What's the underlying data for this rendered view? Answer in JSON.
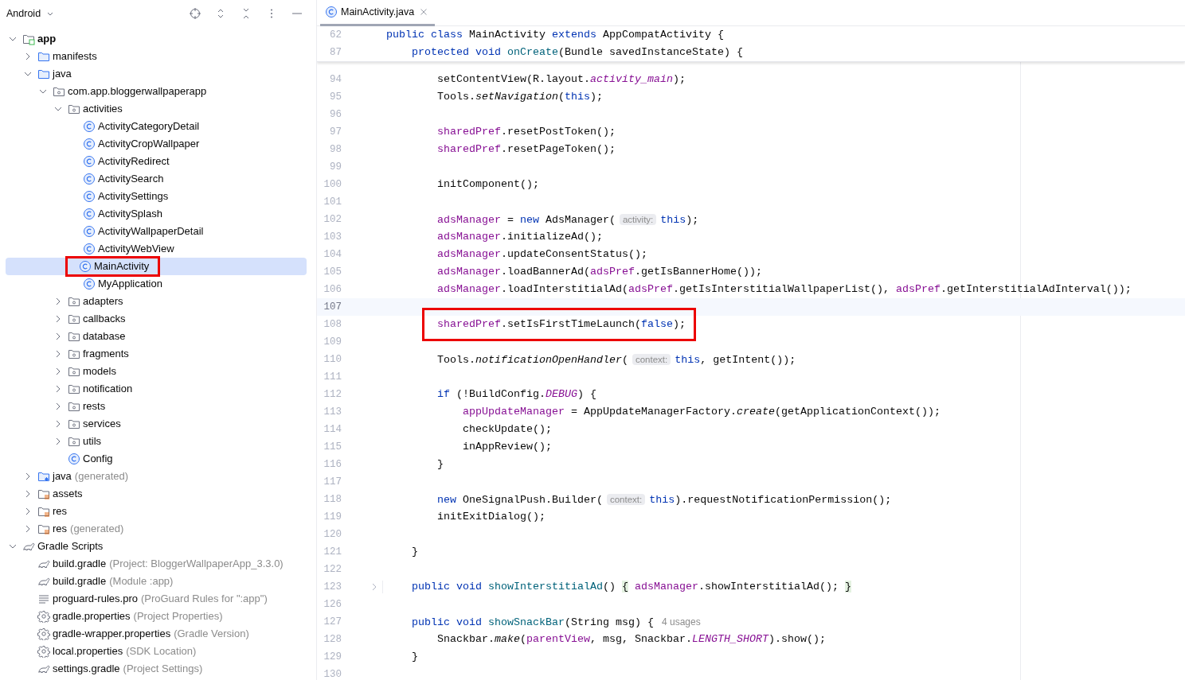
{
  "project_panel": {
    "title": "Android",
    "tree": [
      {
        "kind": "module",
        "label": "app",
        "expanded": true,
        "selected": false,
        "boxed": false,
        "children": [
          {
            "kind": "folder",
            "label": "manifests",
            "expanded": false,
            "selected": false,
            "boxed": false
          },
          {
            "kind": "folder",
            "label": "java",
            "expanded": true,
            "selected": false,
            "boxed": false,
            "children": [
              {
                "kind": "package",
                "label": "com.app.bloggerwallpaperapp",
                "expanded": true,
                "selected": false,
                "boxed": false,
                "children": [
                  {
                    "kind": "package",
                    "label": "activities",
                    "expanded": true,
                    "selected": false,
                    "boxed": false,
                    "children": [
                      {
                        "kind": "class",
                        "label": "ActivityCategoryDetail",
                        "selected": false,
                        "boxed": false
                      },
                      {
                        "kind": "class",
                        "label": "ActivityCropWallpaper",
                        "selected": false,
                        "boxed": false
                      },
                      {
                        "kind": "class",
                        "label": "ActivityRedirect",
                        "selected": false,
                        "boxed": false
                      },
                      {
                        "kind": "class",
                        "label": "ActivitySearch",
                        "selected": false,
                        "boxed": false
                      },
                      {
                        "kind": "class",
                        "label": "ActivitySettings",
                        "selected": false,
                        "boxed": false
                      },
                      {
                        "kind": "class",
                        "label": "ActivitySplash",
                        "selected": false,
                        "boxed": false
                      },
                      {
                        "kind": "class",
                        "label": "ActivityWallpaperDetail",
                        "selected": false,
                        "boxed": false
                      },
                      {
                        "kind": "class",
                        "label": "ActivityWebView",
                        "selected": false,
                        "boxed": false
                      },
                      {
                        "kind": "class",
                        "label": "MainActivity",
                        "selected": true,
                        "boxed": true
                      },
                      {
                        "kind": "class",
                        "label": "MyApplication",
                        "selected": false,
                        "boxed": false
                      }
                    ]
                  },
                  {
                    "kind": "package",
                    "label": "adapters",
                    "expanded": false,
                    "selected": false,
                    "boxed": false
                  },
                  {
                    "kind": "package",
                    "label": "callbacks",
                    "expanded": false,
                    "selected": false,
                    "boxed": false
                  },
                  {
                    "kind": "package",
                    "label": "database",
                    "expanded": false,
                    "selected": false,
                    "boxed": false
                  },
                  {
                    "kind": "package",
                    "label": "fragments",
                    "expanded": false,
                    "selected": false,
                    "boxed": false
                  },
                  {
                    "kind": "package",
                    "label": "models",
                    "expanded": false,
                    "selected": false,
                    "boxed": false
                  },
                  {
                    "kind": "package",
                    "label": "notification",
                    "expanded": false,
                    "selected": false,
                    "boxed": false
                  },
                  {
                    "kind": "package",
                    "label": "rests",
                    "expanded": false,
                    "selected": false,
                    "boxed": false
                  },
                  {
                    "kind": "package",
                    "label": "services",
                    "expanded": false,
                    "selected": false,
                    "boxed": false
                  },
                  {
                    "kind": "package",
                    "label": "utils",
                    "expanded": false,
                    "selected": false,
                    "boxed": false
                  },
                  {
                    "kind": "class",
                    "label": "Config",
                    "selected": false,
                    "boxed": false
                  }
                ]
              }
            ]
          },
          {
            "kind": "gen-folder",
            "label": "java",
            "note": "(generated)",
            "expanded": false,
            "selected": false,
            "boxed": false
          },
          {
            "kind": "res-folder",
            "label": "assets",
            "expanded": false,
            "selected": false,
            "boxed": false
          },
          {
            "kind": "res-folder",
            "label": "res",
            "expanded": false,
            "selected": false,
            "boxed": false
          },
          {
            "kind": "res-folder",
            "label": "res",
            "note": "(generated)",
            "expanded": false,
            "selected": false,
            "boxed": false
          }
        ]
      },
      {
        "kind": "gradle",
        "label": "Gradle Scripts",
        "expanded": true,
        "selected": false,
        "boxed": false,
        "children": [
          {
            "kind": "gradle",
            "label": "build.gradle",
            "note": "(Project: BloggerWallpaperApp_3.3.0)",
            "selected": false,
            "boxed": false
          },
          {
            "kind": "gradle",
            "label": "build.gradle",
            "note": "(Module :app)",
            "selected": false,
            "boxed": false
          },
          {
            "kind": "text-file",
            "label": "proguard-rules.pro",
            "note": "(ProGuard Rules for \":app\")",
            "selected": false,
            "boxed": false
          },
          {
            "kind": "settings-file",
            "label": "gradle.properties",
            "note": "(Project Properties)",
            "selected": false,
            "boxed": false
          },
          {
            "kind": "settings-file",
            "label": "gradle-wrapper.properties",
            "note": "(Gradle Version)",
            "selected": false,
            "boxed": false
          },
          {
            "kind": "settings-file",
            "label": "local.properties",
            "note": "(SDK Location)",
            "selected": false,
            "boxed": false
          },
          {
            "kind": "gradle",
            "label": "settings.gradle",
            "note": "(Project Settings)",
            "selected": false,
            "boxed": false
          }
        ]
      }
    ]
  },
  "editor": {
    "tab": {
      "label": "MainActivity.java",
      "selected": true
    },
    "sticky_lines": [
      {
        "number": "62",
        "tokens": [
          {
            "kind": "keyword",
            "text": "public class"
          },
          {
            "kind": "plain",
            "text": " MainActivity "
          },
          {
            "kind": "keyword",
            "text": "extends"
          },
          {
            "kind": "plain",
            "text": " AppCompatActivity {"
          }
        ]
      },
      {
        "number": "87",
        "tokens": [
          {
            "kind": "keyword",
            "text": "    protected void "
          },
          {
            "kind": "declaration",
            "text": "onCreate"
          },
          {
            "kind": "plain",
            "text": "(Bundle savedInstanceState) {"
          }
        ]
      }
    ],
    "lines": [
      {
        "number": "94",
        "current": false,
        "boxed": false,
        "folded": false,
        "tokens": [
          {
            "kind": "plain",
            "text": "        setContentView(R.layout."
          },
          {
            "kind": "constant",
            "text": "activity_main"
          },
          {
            "kind": "plain",
            "text": ");"
          }
        ]
      },
      {
        "number": "95",
        "current": false,
        "boxed": false,
        "folded": false,
        "tokens": [
          {
            "kind": "plain",
            "text": "        Tools."
          },
          {
            "kind": "static",
            "text": "setNavigation"
          },
          {
            "kind": "plain",
            "text": "("
          },
          {
            "kind": "keyword",
            "text": "this"
          },
          {
            "kind": "plain",
            "text": ");"
          }
        ]
      },
      {
        "number": "96",
        "current": false,
        "boxed": false,
        "folded": false
      },
      {
        "number": "97",
        "current": false,
        "boxed": false,
        "folded": false,
        "tokens": [
          {
            "kind": "field",
            "text": "        sharedPref"
          },
          {
            "kind": "plain",
            "text": ".resetPostToken();"
          }
        ]
      },
      {
        "number": "98",
        "current": false,
        "boxed": false,
        "folded": false,
        "tokens": [
          {
            "kind": "field",
            "text": "        sharedPref"
          },
          {
            "kind": "plain",
            "text": ".resetPageToken();"
          }
        ]
      },
      {
        "number": "99",
        "current": false,
        "boxed": false,
        "folded": false
      },
      {
        "number": "100",
        "current": false,
        "boxed": false,
        "folded": false,
        "tokens": [
          {
            "kind": "plain",
            "text": "        initComponent();"
          }
        ]
      },
      {
        "number": "101",
        "current": false,
        "boxed": false,
        "folded": false
      },
      {
        "number": "102",
        "current": false,
        "boxed": false,
        "folded": false,
        "tokens": [
          {
            "kind": "field",
            "text": "        adsManager"
          },
          {
            "kind": "plain",
            "text": " = "
          },
          {
            "kind": "keyword",
            "text": "new"
          },
          {
            "kind": "plain",
            "text": " AdsManager("
          },
          {
            "kind": "hint",
            "text": "activity:"
          },
          {
            "kind": "keyword",
            "text": "this"
          },
          {
            "kind": "plain",
            "text": ");"
          }
        ]
      },
      {
        "number": "103",
        "current": false,
        "boxed": false,
        "folded": false,
        "tokens": [
          {
            "kind": "field",
            "text": "        adsManager"
          },
          {
            "kind": "plain",
            "text": ".initializeAd();"
          }
        ]
      },
      {
        "number": "104",
        "current": false,
        "boxed": false,
        "folded": false,
        "tokens": [
          {
            "kind": "field",
            "text": "        adsManager"
          },
          {
            "kind": "plain",
            "text": ".updateConsentStatus();"
          }
        ]
      },
      {
        "number": "105",
        "current": false,
        "boxed": false,
        "folded": false,
        "tokens": [
          {
            "kind": "field",
            "text": "        adsManager"
          },
          {
            "kind": "plain",
            "text": ".loadBannerAd("
          },
          {
            "kind": "field",
            "text": "adsPref"
          },
          {
            "kind": "plain",
            "text": ".getIsBannerHome());"
          }
        ]
      },
      {
        "number": "106",
        "current": false,
        "boxed": false,
        "folded": false,
        "tokens": [
          {
            "kind": "field",
            "text": "        adsManager"
          },
          {
            "kind": "plain",
            "text": ".loadInterstitialAd("
          },
          {
            "kind": "field",
            "text": "adsPref"
          },
          {
            "kind": "plain",
            "text": ".getIsInterstitialWallpaperList(), "
          },
          {
            "kind": "field",
            "text": "adsPref"
          },
          {
            "kind": "plain",
            "text": ".getInterstitialAdInterval());"
          }
        ]
      },
      {
        "number": "107",
        "current": true,
        "boxed": false,
        "folded": false
      },
      {
        "number": "108",
        "current": false,
        "boxed": true,
        "folded": false,
        "tokens": [
          {
            "kind": "field",
            "text": "        sharedPref"
          },
          {
            "kind": "plain",
            "text": ".setIsFirstTimeLaunch("
          },
          {
            "kind": "keyword",
            "text": "false"
          },
          {
            "kind": "plain",
            "text": ");"
          }
        ]
      },
      {
        "number": "109",
        "current": false,
        "boxed": false,
        "folded": false
      },
      {
        "number": "110",
        "current": false,
        "boxed": false,
        "folded": false,
        "tokens": [
          {
            "kind": "plain",
            "text": "        Tools."
          },
          {
            "kind": "static",
            "text": "notificationOpenHandler"
          },
          {
            "kind": "plain",
            "text": "("
          },
          {
            "kind": "hint",
            "text": "context:"
          },
          {
            "kind": "keyword",
            "text": "this"
          },
          {
            "kind": "plain",
            "text": ", getIntent());"
          }
        ]
      },
      {
        "number": "111",
        "current": false,
        "boxed": false,
        "folded": false
      },
      {
        "number": "112",
        "current": false,
        "boxed": false,
        "folded": false,
        "tokens": [
          {
            "kind": "keyword",
            "text": "        if"
          },
          {
            "kind": "plain",
            "text": " (!BuildConfig."
          },
          {
            "kind": "constant",
            "text": "DEBUG"
          },
          {
            "kind": "plain",
            "text": ") {"
          }
        ]
      },
      {
        "number": "113",
        "current": false,
        "boxed": false,
        "folded": false,
        "tokens": [
          {
            "kind": "field",
            "text": "            appUpdateManager"
          },
          {
            "kind": "plain",
            "text": " = AppUpdateManagerFactory."
          },
          {
            "kind": "static",
            "text": "create"
          },
          {
            "kind": "plain",
            "text": "(getApplicationContext());"
          }
        ]
      },
      {
        "number": "114",
        "current": false,
        "boxed": false,
        "folded": false,
        "tokens": [
          {
            "kind": "plain",
            "text": "            checkUpdate();"
          }
        ]
      },
      {
        "number": "115",
        "current": false,
        "boxed": false,
        "folded": false,
        "tokens": [
          {
            "kind": "plain",
            "text": "            inAppReview();"
          }
        ]
      },
      {
        "number": "116",
        "current": false,
        "boxed": false,
        "folded": false,
        "tokens": [
          {
            "kind": "plain",
            "text": "        }"
          }
        ]
      },
      {
        "number": "117",
        "current": false,
        "boxed": false,
        "folded": false
      },
      {
        "number": "118",
        "current": false,
        "boxed": false,
        "folded": false,
        "tokens": [
          {
            "kind": "keyword",
            "text": "        new"
          },
          {
            "kind": "plain",
            "text": " OneSignalPush.Builder("
          },
          {
            "kind": "hint",
            "text": "context:"
          },
          {
            "kind": "keyword",
            "text": "this"
          },
          {
            "kind": "plain",
            "text": ").requestNotificationPermission();"
          }
        ]
      },
      {
        "number": "119",
        "current": false,
        "boxed": false,
        "folded": false,
        "tokens": [
          {
            "kind": "plain",
            "text": "        initExitDialog();"
          }
        ]
      },
      {
        "number": "120",
        "current": false,
        "boxed": false,
        "folded": false
      },
      {
        "number": "121",
        "current": false,
        "boxed": false,
        "folded": false,
        "tokens": [
          {
            "kind": "plain",
            "text": "    }"
          }
        ]
      },
      {
        "number": "122",
        "current": false,
        "boxed": false,
        "folded": false
      },
      {
        "number": "123",
        "current": false,
        "boxed": false,
        "folded": true,
        "tokens": [
          {
            "kind": "keyword",
            "text": "    public void "
          },
          {
            "kind": "declaration",
            "text": "showInterstitialAd"
          },
          {
            "kind": "plain",
            "text": "() "
          },
          {
            "kind": "brace",
            "text": "{"
          },
          {
            "kind": "field",
            "text": " adsManager"
          },
          {
            "kind": "plain",
            "text": ".showInterstitialAd(); "
          },
          {
            "kind": "brace",
            "text": "}"
          }
        ]
      },
      {
        "number": "126",
        "current": false,
        "boxed": false,
        "folded": false
      },
      {
        "number": "127",
        "current": false,
        "boxed": false,
        "folded": false,
        "tokens": [
          {
            "kind": "keyword",
            "text": "    public void "
          },
          {
            "kind": "declaration",
            "text": "showSnackBar"
          },
          {
            "kind": "plain",
            "text": "(String msg) {"
          },
          {
            "kind": "usages",
            "text": "4 usages"
          }
        ]
      },
      {
        "number": "128",
        "current": false,
        "boxed": false,
        "folded": false,
        "tokens": [
          {
            "kind": "plain",
            "text": "        Snackbar."
          },
          {
            "kind": "static",
            "text": "make"
          },
          {
            "kind": "plain",
            "text": "("
          },
          {
            "kind": "field",
            "text": "parentView"
          },
          {
            "kind": "plain",
            "text": ", msg, Snackbar."
          },
          {
            "kind": "constant",
            "text": "LENGTH_SHORT"
          },
          {
            "kind": "plain",
            "text": ").show();"
          }
        ]
      },
      {
        "number": "129",
        "current": false,
        "boxed": false,
        "folded": false,
        "tokens": [
          {
            "kind": "plain",
            "text": "    }"
          }
        ]
      },
      {
        "number": "130",
        "current": false,
        "boxed": false,
        "folded": false
      }
    ]
  }
}
